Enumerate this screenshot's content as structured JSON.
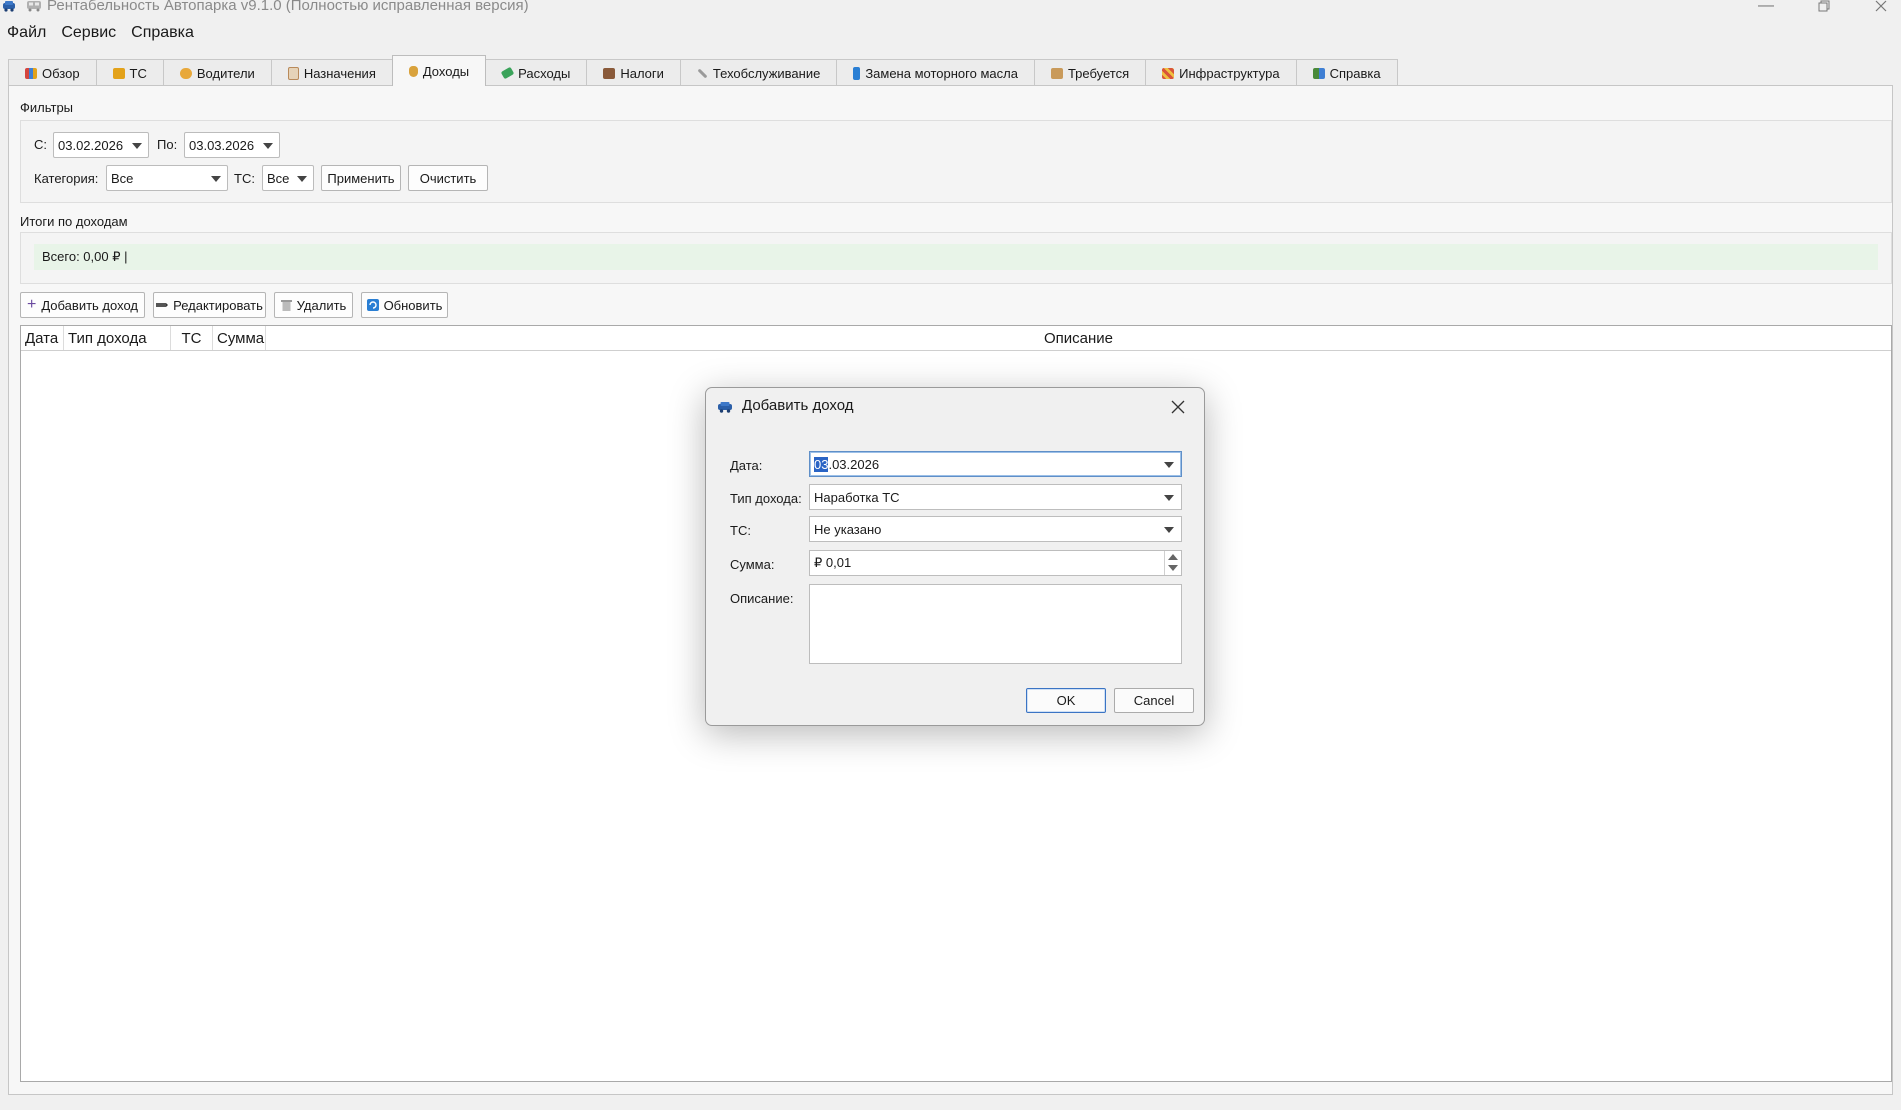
{
  "window": {
    "title": "Рентабельность Автопарка v9.1.0 (Полностью исправленная версия)"
  },
  "menu": [
    {
      "label": "Файл"
    },
    {
      "label": "Сервис"
    },
    {
      "label": "Справка"
    }
  ],
  "tabs": [
    {
      "label": "Обзор",
      "icon": "chart-icon",
      "color": "#d4463f"
    },
    {
      "label": "ТС",
      "icon": "truck-icon",
      "color": "#e3a21a"
    },
    {
      "label": "Водители",
      "icon": "driver-icon",
      "color": "#e8a83a"
    },
    {
      "label": "Назначения",
      "icon": "clipboard-icon",
      "color": "#b98a5a"
    },
    {
      "label": "Доходы",
      "icon": "money-bag-icon",
      "color": "#d9a23c",
      "active": true
    },
    {
      "label": "Расходы",
      "icon": "money-wings-icon",
      "color": "#3aa35a"
    },
    {
      "label": "Налоги",
      "icon": "briefcase-icon",
      "color": "#8a5a3a"
    },
    {
      "label": "Техобслуживание",
      "icon": "wrench-icon",
      "color": "#8a8a8a"
    },
    {
      "label": "Замена моторного масла",
      "icon": "oil-icon",
      "color": "#2a7fd4"
    },
    {
      "label": "Требуется",
      "icon": "package-icon",
      "color": "#c99a5a"
    },
    {
      "label": "Инфраструктура",
      "icon": "construction-icon",
      "color": "#d9543a"
    },
    {
      "label": "Справка",
      "icon": "books-icon",
      "color": "#4a8a3a"
    }
  ],
  "filters": {
    "title": "Фильтры",
    "from_label": "С:",
    "from_value": "03.02.2026",
    "to_label": "По:",
    "to_value": "03.03.2026",
    "category_label": "Категория:",
    "category_value": "Все",
    "vehicle_label": "ТС:",
    "vehicle_value": "Все",
    "apply_label": "Применить",
    "clear_label": "Очистить"
  },
  "totals": {
    "title": "Итоги по доходам",
    "text": "Всего: 0,00 ₽ |"
  },
  "toolbar": {
    "add_label": "Добавить доход",
    "edit_label": "Редактировать",
    "delete_label": "Удалить",
    "refresh_label": "Обновить"
  },
  "table": {
    "columns": [
      "Дата",
      "Тип дохода",
      "ТС",
      "Сумма",
      "Описание"
    ],
    "rows": []
  },
  "dialog": {
    "title": "Добавить доход",
    "date_label": "Дата:",
    "date_selected": "03",
    "date_rest": ".03.2026",
    "type_label": "Тип дохода:",
    "type_value": "Наработка ТС",
    "vehicle_label": "ТС:",
    "vehicle_value": "Не указано",
    "amount_label": "Сумма:",
    "amount_value": "₽ 0,01",
    "description_label": "Описание:",
    "description_value": "",
    "ok_label": "OK",
    "cancel_label": "Cancel"
  }
}
